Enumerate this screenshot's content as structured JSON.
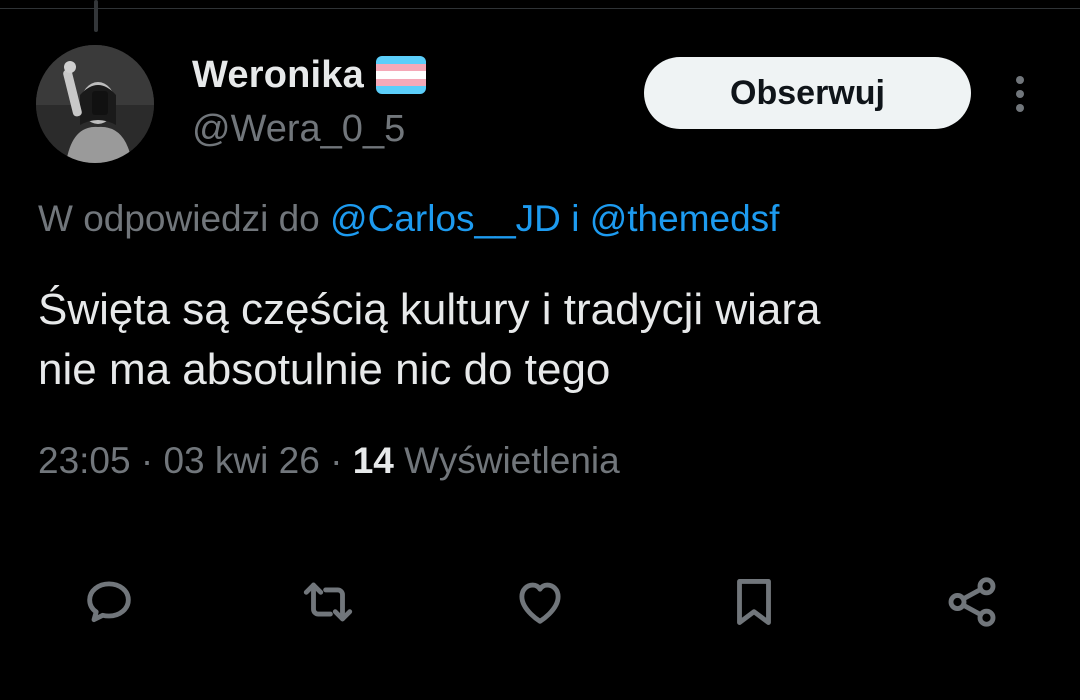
{
  "author": {
    "display_name": "Weronika",
    "handle": "@Wera_0_5",
    "flag_icon": "transgender-flag-icon",
    "flag_colors": [
      "#5bcefa",
      "#f5a9b8",
      "#ffffff",
      "#f5a9b8",
      "#5bcefa"
    ]
  },
  "follow_button": {
    "label": "Obserwuj"
  },
  "more_button": {
    "icon": "more-vertical-icon"
  },
  "reply_context": {
    "prefix": "W odpowiedzi do",
    "mention_1": "@Carlos__JD",
    "conjunction": "i",
    "mention_2": "@themedsf"
  },
  "tweet": {
    "text_line_1": "Święta są częścią kultury i tradycji wiara",
    "text_line_2": "nie ma absotulnie nic do tego"
  },
  "meta": {
    "time": "23:05",
    "separator": "·",
    "date": "03 kwi 26",
    "views_count": "14",
    "views_label": "Wyświetlenia"
  },
  "actions": [
    {
      "icon": "reply-icon"
    },
    {
      "icon": "retweet-icon"
    },
    {
      "icon": "like-heart-icon"
    },
    {
      "icon": "bookmark-icon"
    },
    {
      "icon": "share-icon"
    }
  ],
  "colors": {
    "background": "#000000",
    "primary_text": "#e7e9ea",
    "secondary_text": "#71767b",
    "link": "#1d9bf0",
    "button_bg": "#eff3f4",
    "button_text": "#0f1419"
  }
}
